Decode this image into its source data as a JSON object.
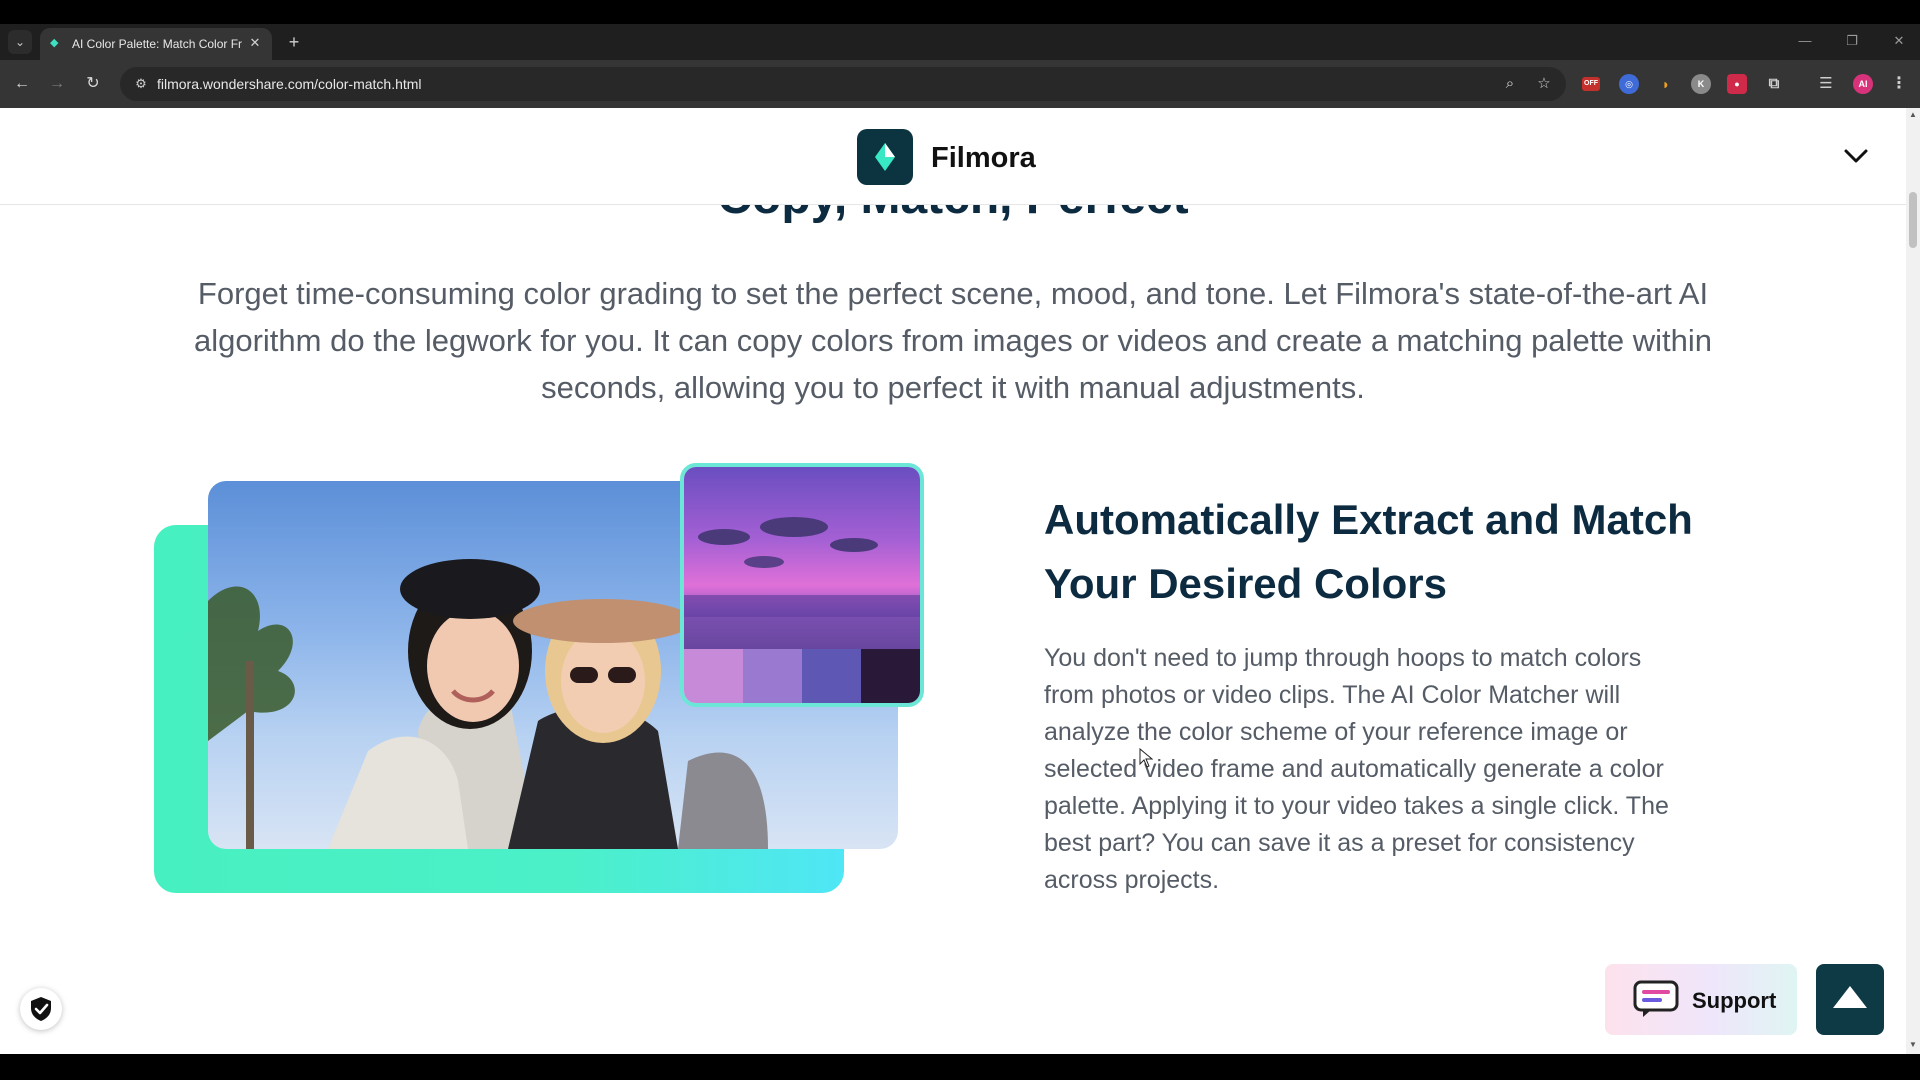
{
  "browser": {
    "tab_title": "AI Color Palette: Match Color Fr",
    "url": "filmora.wondershare.com/color-match.html",
    "icons": [
      "tab-list-icon",
      "close-icon",
      "plus-icon",
      "back-arrow-icon",
      "forward-arrow-icon",
      "reload-icon",
      "site-settings-icon",
      "zoom-icon",
      "star-icon",
      "extensions-icon",
      "reading-list-icon",
      "profile-avatar",
      "kebab-menu-icon"
    ],
    "profile_initials": "AI",
    "ext_label": "OFF"
  },
  "header": {
    "brand": "Filmora"
  },
  "hero": {
    "heading": "Copy, Match, Perfect",
    "intro": "Forget time-consuming color grading to set the perfect scene, mood, and tone. Let Filmora's state-of-the-art AI algorithm do the legwork for you. It can copy colors from images or videos and create a matching palette within seconds, allowing you to perfect it with manual adjustments."
  },
  "feature": {
    "title": "Automatically Extract and Match Your Desired Colors",
    "body": "You don't need to jump through hoops to match colors from photos or video clips. The AI Color Matcher will analyze the color scheme of your reference image or selected video frame and automatically generate a color palette. Applying it to your video takes a single click. The best part? You can save it as a preset for consistency across projects."
  },
  "palette": {
    "swatches": [
      "#c78ad8",
      "#9a7ad0",
      "#5e58b4",
      "#2a1838"
    ]
  },
  "widgets": {
    "support_label": "Support"
  },
  "colors": {
    "heading": "#0c2a40",
    "body_text": "#555c66",
    "accent_teal": "#47f0c0",
    "logo_bg": "#0c3340",
    "back_to_top_bg": "#0e3a46"
  }
}
